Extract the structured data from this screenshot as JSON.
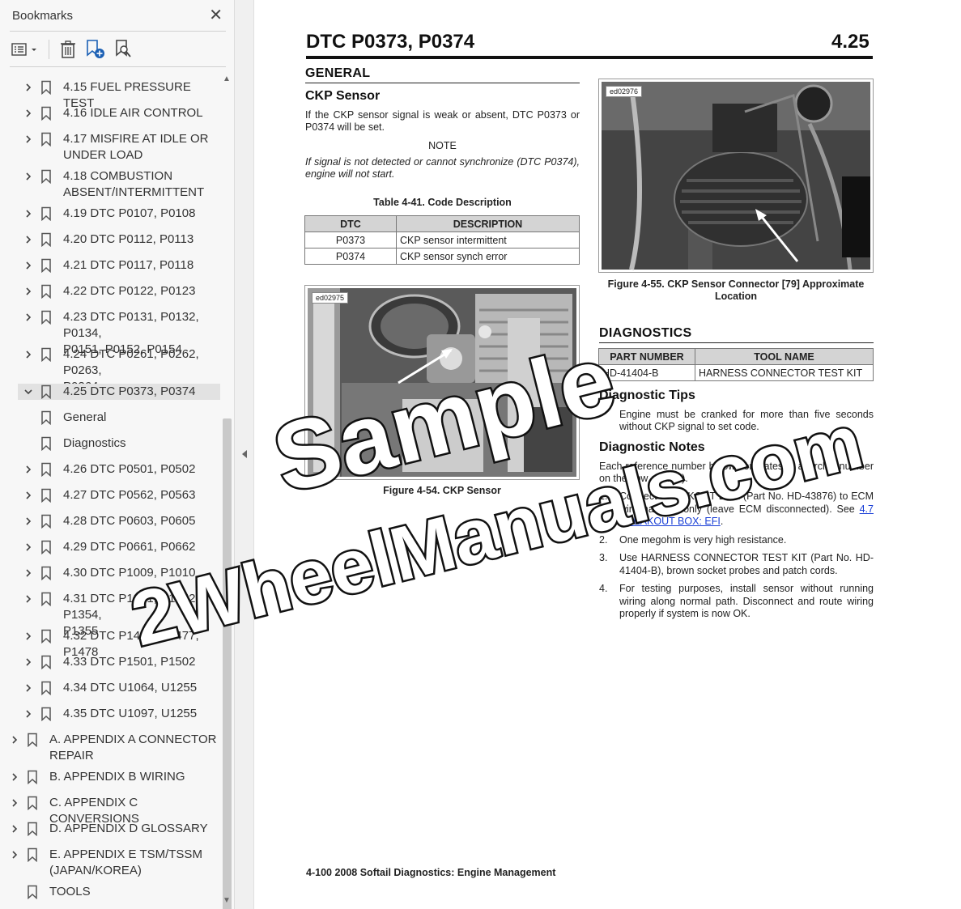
{
  "sidebar": {
    "title": "Bookmarks",
    "items": [
      {
        "label": "4.15 FUEL PRESSURE TEST"
      },
      {
        "label": "4.16 IDLE AIR CONTROL"
      },
      {
        "label": "4.17 MISFIRE AT IDLE OR UNDER LOAD",
        "line1": "4.17 MISFIRE AT IDLE OR",
        "line2": "UNDER LOAD"
      },
      {
        "label": "4.18 COMBUSTION ABSENT/INTERMITTENT",
        "line1": "4.18 COMBUSTION",
        "line2": "ABSENT/INTERMITTENT"
      },
      {
        "label": "4.19 DTC P0107, P0108"
      },
      {
        "label": "4.20 DTC P0112, P0113"
      },
      {
        "label": "4.21 DTC P0117, P0118"
      },
      {
        "label": "4.22 DTC P0122, P0123"
      },
      {
        "label": "4.23 DTC P0131, P0132, P0134, P0151, P0152, P0154",
        "line1": "4.23 DTC P0131, P0132, P0134,",
        "line2": "P0151, P0152, P0154"
      },
      {
        "label": "4.24 DTC P0261, P0262, P0263, P0264",
        "line1": "4.24 DTC P0261, P0262, P0263,",
        "line2": "P0264"
      },
      {
        "label": "4.25 DTC P0373, P0374"
      },
      {
        "label": "General"
      },
      {
        "label": "Diagnostics"
      },
      {
        "label": "4.26 DTC P0501, P0502"
      },
      {
        "label": "4.27 DTC P0562, P0563"
      },
      {
        "label": "4.28 DTC P0603, P0605"
      },
      {
        "label": "4.29 DTC P0661, P0662"
      },
      {
        "label": "4.30 DTC P1009, P1010"
      },
      {
        "label": "4.31 DTC P1351, P1352, P1354, P1355",
        "line1": "4.31 DTC P1351, P1352, P1354,",
        "line2": "P1355"
      },
      {
        "label": "4.32 DTC P1475, P1477, P1478"
      },
      {
        "label": "4.33 DTC P1501, P1502"
      },
      {
        "label": "4.34 DTC U1064, U1255"
      },
      {
        "label": "4.35 DTC U1097, U1255"
      },
      {
        "label": "A. APPENDIX A CONNECTOR REPAIR",
        "line1": "A. APPENDIX A CONNECTOR",
        "line2": "REPAIR"
      },
      {
        "label": "B. APPENDIX B WIRING"
      },
      {
        "label": "C. APPENDIX C CONVERSIONS"
      },
      {
        "label": "D. APPENDIX D GLOSSARY"
      },
      {
        "label": "E. APPENDIX E TSM/TSSM (JAPAN/KOREA)",
        "line1": "E. APPENDIX E TSM/TSSM",
        "line2": "(JAPAN/KOREA)"
      },
      {
        "label": "TOOLS"
      }
    ]
  },
  "doc": {
    "title": "DTC P0373, P0374",
    "section_number": "4.25",
    "general_heading": "GENERAL",
    "ckp_heading": "CKP Sensor",
    "ckp_text": "If the CKP sensor signal is weak or absent, DTC P0373 or P0374 will be set.",
    "note_label": "NOTE",
    "note_text": "If signal is not detected or cannot synchronize (DTC P0374), engine will not start.",
    "table_caption": "Table 4-41. Code Description",
    "code_table": {
      "headers": [
        "DTC",
        "DESCRIPTION"
      ],
      "rows": [
        [
          "P0373",
          "CKP sensor intermittent"
        ],
        [
          "P0374",
          "CKP sensor synch error"
        ]
      ]
    },
    "fig54_tag": "ed02975",
    "fig54_caption": "Figure 4-54. CKP Sensor",
    "fig55_tag": "ed02976",
    "fig55_caption": "Figure 4-55. CKP Sensor Connector [79] Approximate Location",
    "diagnostics_heading": "DIAGNOSTICS",
    "tool_table": {
      "headers": [
        "PART NUMBER",
        "TOOL NAME"
      ],
      "rows": [
        [
          "HD-41404-B",
          "HARNESS CONNECTOR TEST KIT"
        ]
      ]
    },
    "tips_heading": "Diagnostic Tips",
    "tips_bullet": "•",
    "tips_text": "Engine must be cranked for more than five seconds without CKP signal to set code.",
    "notes_heading": "Diagnostic Notes",
    "notes_intro": "Each reference number below correlates to a circled number on the flow chart(s).",
    "steps": [
      {
        "num": "1.",
        "text": "Connect BREAKOUT BOX (Part No. HD-43876) to ECM wire harness only (leave ECM disconnected). See ",
        "link": "4.7 BREAKOUT BOX: EFI",
        "after": "."
      },
      {
        "num": "2.",
        "text": "One megohm is very high resistance."
      },
      {
        "num": "3.",
        "text": "Use HARNESS CONNECTOR TEST KIT (Part No. HD-41404-B), brown socket probes and patch cords."
      },
      {
        "num": "4.",
        "text": "For testing purposes, install sensor without running wiring along normal path. Disconnect and route wiring properly if system is now OK."
      }
    ],
    "footer": "4-100  2008 Softail Diagnostics:  Engine Management"
  },
  "watermark": {
    "line1": "Sample",
    "line2": "2WheelManuals.com"
  },
  "colors": {
    "sidebar_bg": "#f7f7f7",
    "selected_bg": "#e2e2e2",
    "link": "#1a3fd6",
    "table_header": "#d4d4d4"
  }
}
